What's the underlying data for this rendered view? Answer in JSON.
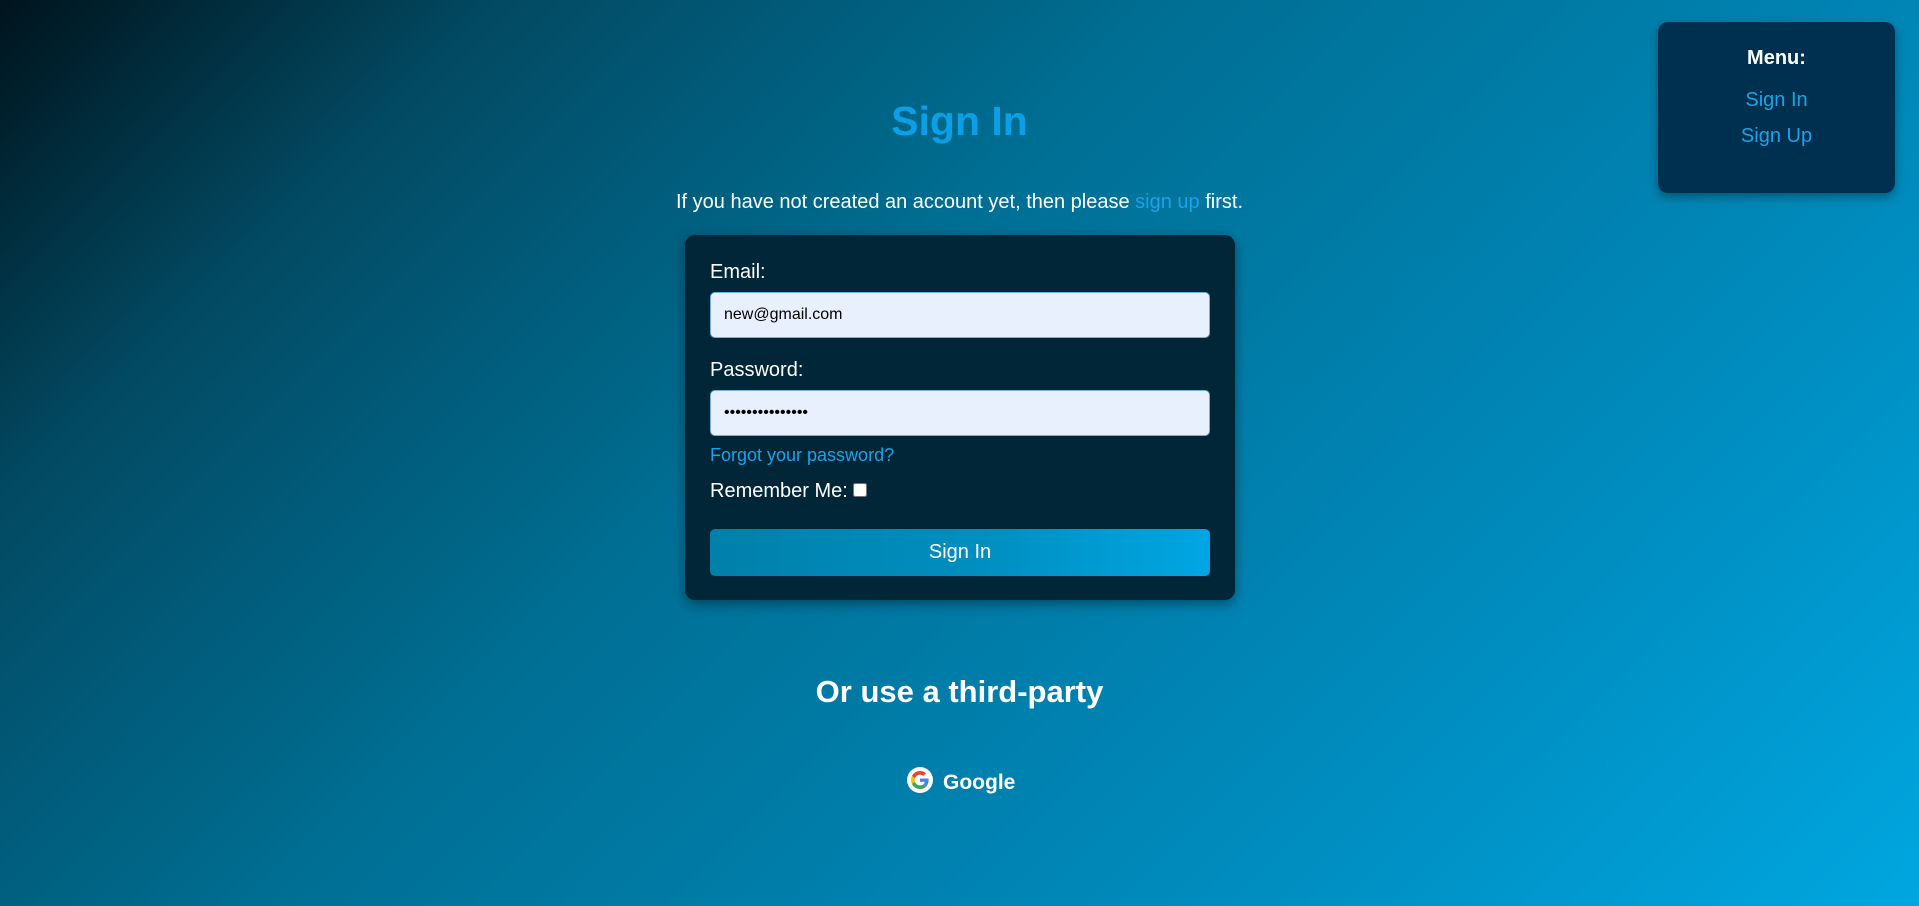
{
  "menu": {
    "title": "Menu:",
    "items": [
      {
        "label": "Sign In"
      },
      {
        "label": "Sign Up"
      }
    ]
  },
  "page": {
    "title": "Sign In",
    "intro_before": "If you have not created an account yet, then please ",
    "intro_link": "sign up",
    "intro_after": " first."
  },
  "form": {
    "email_label": "Email:",
    "email_value": "new@gmail.com",
    "password_label": "Password:",
    "password_value": "•••••••••••••••",
    "forgot_label": "Forgot your password?",
    "remember_label": "Remember Me:",
    "remember_checked": false,
    "submit_label": "Sign In"
  },
  "third_party": {
    "heading": "Or use a third-party",
    "providers": [
      {
        "label": "Google",
        "icon": "google-icon"
      }
    ]
  },
  "colors": {
    "accent": "#1aa3e8",
    "title": "#0a9fe6",
    "card": "#012638",
    "menu_box": "#00304f"
  }
}
